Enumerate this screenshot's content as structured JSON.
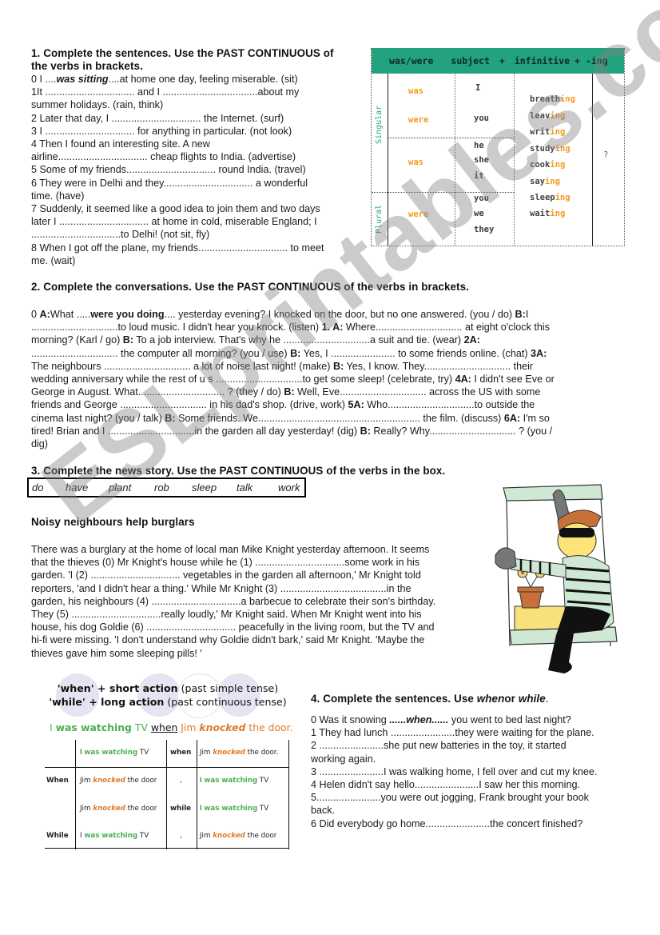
{
  "watermark": "ESLprintables.com",
  "section1": {
    "heading_line1": "1. Complete the sentences. Use the PAST CONTINUOUS of",
    "heading_line2": "the verbs in brackets.",
    "lines": [
      {
        "pre": "0 I ....",
        "answer": "was sitting",
        "post": "....at home one day, feeling miserable. (sit)"
      },
      {
        "text": "1It ................................ and I ..................................about my"
      },
      {
        "text": "summer holidays. (rain, think)"
      },
      {
        "text": "2 Later that day, I ................................ the Internet. (surf)"
      },
      {
        "text": "3 I ................................ for anything in particular. (not look)"
      },
      {
        "text": "4 Then I found an interesting site. A new"
      },
      {
        "text": "airline................................ cheap flights to India. (advertise)"
      },
      {
        "text": "5 Some of my friends................................ round India. (travel)"
      },
      {
        "text": "6 They were in Delhi and they................................ a wonderful"
      },
      {
        "text": "time. (have)"
      },
      {
        "text": "7 Suddenly, it seemed like a good idea to join them and two days"
      },
      {
        "text": "later I ................................ at home in cold, miserable England; I"
      },
      {
        "text": "................................to Delhi! (not sit, fly)"
      },
      {
        "text": "8 When I got off the plane, my friends................................ to meet"
      },
      {
        "text": "me. (wait)"
      }
    ]
  },
  "form_table": {
    "header": [
      "was/were",
      "subject",
      "+",
      "infinitive",
      "+ -ing"
    ],
    "side_labels": {
      "singular": "Singular",
      "plural": "Plural"
    },
    "was_were": [
      "was",
      "were",
      "was",
      "were"
    ],
    "subjects": [
      "I",
      "you",
      "he",
      "she",
      "it",
      "you",
      "we",
      "they"
    ],
    "verbs": [
      {
        "stem": "breath",
        "ending": "ing"
      },
      {
        "stem": "leav",
        "ending": "ing"
      },
      {
        "stem": "writ",
        "ending": "ing"
      },
      {
        "stem": "study",
        "ending": "ing"
      },
      {
        "stem": "cook",
        "ending": "ing"
      },
      {
        "stem": "say",
        "ending": "ing"
      },
      {
        "stem": "sleep",
        "ending": "ing"
      },
      {
        "stem": "wait",
        "ending": "ing"
      }
    ],
    "question_mark": "?",
    "colors": {
      "header_bg": "#22a27f",
      "accent": "#f29b1d"
    }
  },
  "section2": {
    "heading": "2. Complete the conversations. Use the PAST CONTINUOUS of the verbs in brackets.",
    "lines": [
      [
        {
          "t": "0 "
        },
        {
          "b": "A:"
        },
        {
          "t": "What ....."
        },
        {
          "b": "were you doing"
        },
        {
          "t": ".... yesterday evening? I knocked on the door, but no one answered. (you / do) "
        },
        {
          "b": "B:"
        },
        {
          "t": "I"
        }
      ],
      [
        {
          "t": "...............................to loud music. I didn't hear you knock. (listen) "
        },
        {
          "b": "1. A:"
        },
        {
          "t": " Where............................... at eight o'clock this"
        }
      ],
      [
        {
          "t": "morning? (Karl / go) "
        },
        {
          "b": "B:"
        },
        {
          "t": " To a job interview. That's why he ...............................a suit and tie. (wear) "
        },
        {
          "b": "2A:"
        }
      ],
      [
        {
          "t": "............................... the computer all morning? (you / use) "
        },
        {
          "b": "B:"
        },
        {
          "t": " Yes, I ....................... to some friends online. (chat) "
        },
        {
          "b": "3A:"
        }
      ],
      [
        {
          "t": "The neighbours ............................... a lot of noise last night! (make) "
        },
        {
          "b": "B:"
        },
        {
          "t": " Yes, I know. They............................... their"
        }
      ],
      [
        {
          "t": "wedding anniversary while the rest of u s ...............................to get some sleep! (celebrate, try) "
        },
        {
          "b": "4A:"
        },
        {
          "t": " I didn't see Eve or"
        }
      ],
      [
        {
          "t": "George in August. What............................... ? (they / do) "
        },
        {
          "b": "B:"
        },
        {
          "t": " Well, Eve............................... across the US with some"
        }
      ],
      [
        {
          "t": "friends and George ............................... in his dad's shop. (drive, work) "
        },
        {
          "b": "5A:"
        },
        {
          "t": " Who...............................to outside the"
        }
      ],
      [
        {
          "t": "cinema last night? (you / talk) "
        },
        {
          "b": "B:"
        },
        {
          "t": " Some friends. We.......................................................... the film. (discuss) "
        },
        {
          "b": "6A:"
        },
        {
          "t": " I'm so"
        }
      ],
      [
        {
          "t": "tired! Brian and I ...............................in the garden all day yesterday! (dig) "
        },
        {
          "b": "B:"
        },
        {
          "t": " Really? Why............................... ? (you /"
        }
      ],
      [
        {
          "t": "dig)"
        }
      ]
    ]
  },
  "section3": {
    "heading": "3. Complete the news story. Use the PAST CONTINUOUS of the verbs in the box.",
    "word_box": [
      "do",
      "have",
      "plant",
      "rob",
      "sleep",
      "talk",
      "work"
    ],
    "story_title": "Noisy neighbours help burglars",
    "story_lines": [
      "There was a burglary at the home of local man Mike Knight yesterday afternoon. It seems",
      "that the thieves (0) Mr Knight's house while he (1) ................................some work in his",
      "garden. 'I (2) ................................ vegetables in the garden all afternoon,' Mr Knight told",
      "reporters, 'and I didn't hear a thing.' While Mr Knight (3) ......................................in the",
      "garden, his neighbours (4) ................................a barbecue to celebrate their son's birthday.",
      "They (5) ................................really loudly,' Mr Knight said. When Mr Knight went into his",
      "house, his dog Goldie (6) ................................ peacefully in the living room, but the TV and",
      "hi-fi were missing. 'I don't understand why Goldie didn't bark,' said Mr Knight. 'Maybe the",
      "thieves gave him some sleeping pills! '"
    ],
    "illustration": "burglar-climbing-through-window"
  },
  "rule_box": {
    "when_rule": {
      "word": "'when'",
      "plus": " + short action",
      "note": " (past simple tense)"
    },
    "while_rule": {
      "word": "'while'",
      "plus": "  + long action",
      "note": " (past continuous tense)"
    },
    "example": {
      "p1": "I ",
      "p2": "was watching",
      "p3": " TV ",
      "p4": "when",
      "p5": " Jim ",
      "p6": "knocked",
      "p7": " the door."
    },
    "table": {
      "row0": {
        "label": "",
        "a_pre": "I ",
        "a_hl": "was watching",
        "a_post": " TV",
        "mid": "when",
        "b_pre": "Jim ",
        "b_hl": "knocked",
        "b_post": " the door."
      },
      "row1": {
        "label": "When",
        "a_pre": "Jim ",
        "a_hl": "knocked",
        "a_post": " the door",
        "mid": ",",
        "b_pre": "I ",
        "b_hl": "was watching",
        "b_post": " TV"
      },
      "row2": {
        "label": "",
        "a_pre": "Jim ",
        "a_hl": "knocked",
        "a_post": " the door",
        "mid": "while",
        "b_pre": "I ",
        "b_hl": "was watching",
        "b_post": " TV"
      },
      "row3": {
        "label": "While",
        "a_pre": "I ",
        "a_hl": "was watching",
        "a_post": " TV",
        "mid": ",",
        "b_pre": "Jim ",
        "b_hl": "knocked",
        "b_post": " the door"
      }
    },
    "colors": {
      "green": "#4caf50",
      "orange": "#e07b2a"
    }
  },
  "section4": {
    "heading_pre": "4. Complete the sentences. Use ",
    "heading_when": "when",
    "heading_or": "or ",
    "heading_while": "while",
    "heading_end": ".",
    "line0": {
      "pre": "0 Was it snowing ",
      "answer": "......when......",
      "post": " you went to bed last night?"
    },
    "lines": [
      "1 They had lunch .......................they were waiting for the plane.",
      "2 .......................she put new batteries in the toy, it started",
      "working again.",
      "3 .......................I was walking home, I fell over and cut my knee.",
      "4 Helen didn't say hello.......................I saw her this morning.",
      "5.......................you were out jogging, Frank brought your book",
      "back.",
      "6 Did everybody go home.......................the concert finished?"
    ]
  }
}
